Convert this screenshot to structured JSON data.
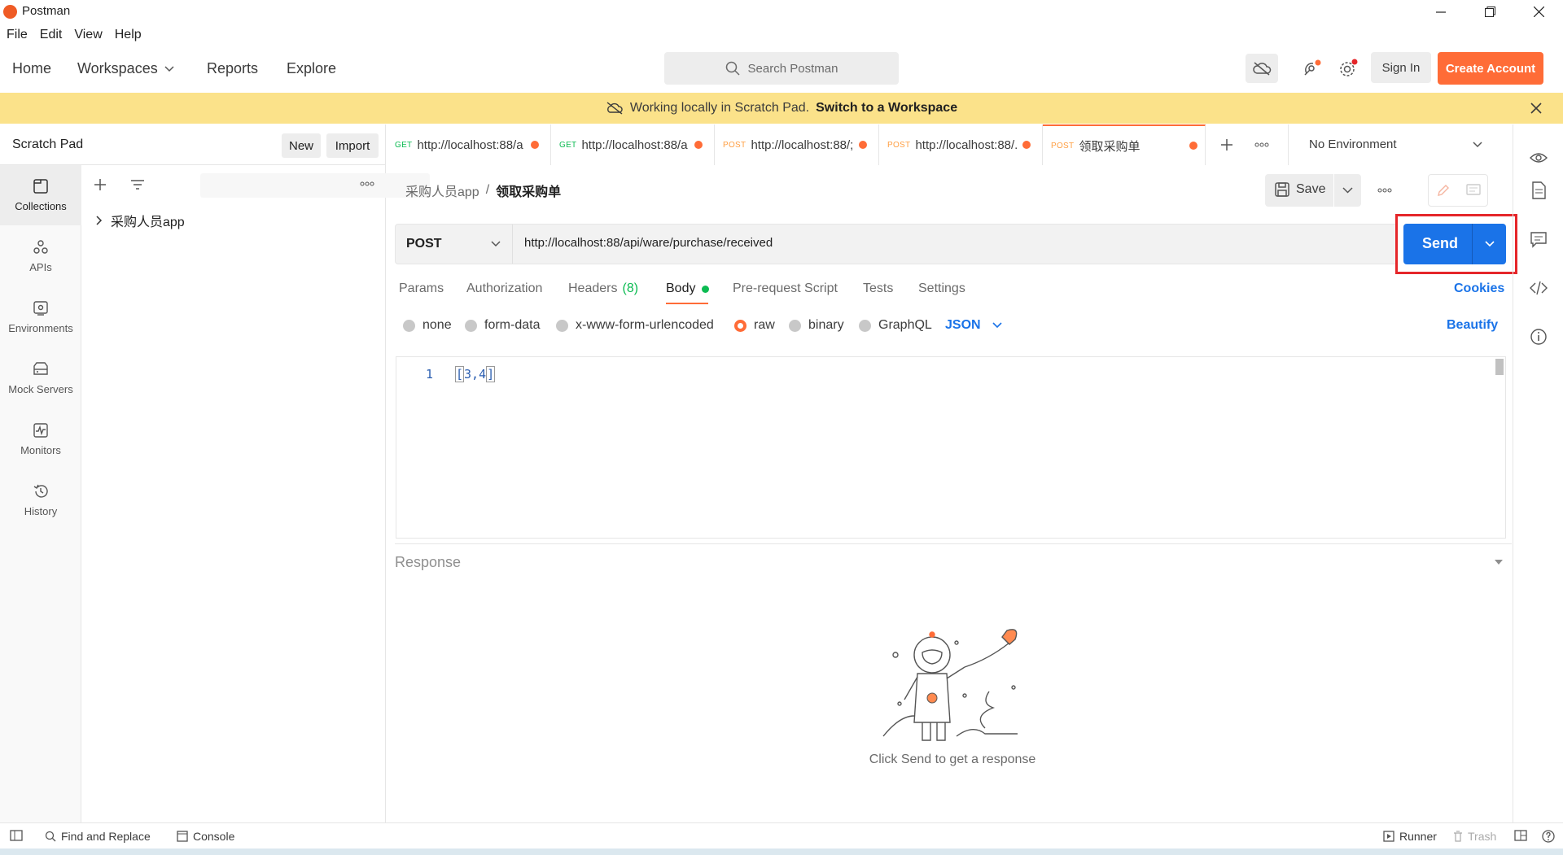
{
  "window": {
    "title": "Postman",
    "controls": [
      "minimize-icon",
      "restore-icon",
      "close-icon"
    ]
  },
  "menu": [
    "File",
    "Edit",
    "View",
    "Help"
  ],
  "topnav": {
    "home": "Home",
    "workspaces": "Workspaces",
    "reports": "Reports",
    "explore": "Explore",
    "search_placeholder": "Search Postman",
    "sign_in": "Sign In",
    "create_account": "Create Account"
  },
  "banner": {
    "text": "Working locally in Scratch Pad.",
    "link": "Switch to a Workspace"
  },
  "sidebar": {
    "title": "Scratch Pad",
    "new_label": "New",
    "import_label": "Import",
    "rail": [
      {
        "label": "Collections",
        "icon": "collections-icon"
      },
      {
        "label": "APIs",
        "icon": "apis-icon"
      },
      {
        "label": "Environments",
        "icon": "environments-icon"
      },
      {
        "label": "Mock Servers",
        "icon": "mock-servers-icon"
      },
      {
        "label": "Monitors",
        "icon": "monitors-icon"
      },
      {
        "label": "History",
        "icon": "history-icon"
      }
    ],
    "collection": "采购人员app"
  },
  "tabs": [
    {
      "method": "GET",
      "title": "http://localhost:88/a"
    },
    {
      "method": "GET",
      "title": "http://localhost:88/a"
    },
    {
      "method": "POST",
      "title": "http://localhost:88/;"
    },
    {
      "method": "POST",
      "title": "http://localhost:88/."
    },
    {
      "method": "POST",
      "title": "领取采购单"
    }
  ],
  "environment": "No Environment",
  "request": {
    "breadcrumb_parent": "采购人员app",
    "breadcrumb_sep": "/",
    "breadcrumb_current": "领取采购单",
    "save_label": "Save",
    "method": "POST",
    "url": "http://localhost:88/api/ware/purchase/received",
    "send_label": "Send",
    "tabs": {
      "params": "Params",
      "authorization": "Authorization",
      "headers": "Headers",
      "headers_count": "(8)",
      "body": "Body",
      "prerequest": "Pre-request Script",
      "tests": "Tests",
      "settings": "Settings",
      "cookies": "Cookies"
    },
    "body_types": {
      "none": "none",
      "form_data": "form-data",
      "urlencoded": "x-www-form-urlencoded",
      "raw": "raw",
      "binary": "binary",
      "graphql": "GraphQL",
      "format": "JSON",
      "beautify": "Beautify",
      "selected": "raw"
    },
    "editor": {
      "line_no": "1",
      "code_open": "[",
      "code_mid": "3,4",
      "code_close": "]"
    }
  },
  "response": {
    "title": "Response",
    "empty_message": "Click Send to get a response"
  },
  "footer": {
    "find_replace": "Find and Replace",
    "console": "Console",
    "runner": "Runner",
    "trash": "Trash"
  },
  "colors": {
    "brand_orange": "#ff6c37",
    "send_blue": "#1a73e8",
    "banner_yellow": "#fbe28a",
    "highlight_red": "#e5262a"
  }
}
